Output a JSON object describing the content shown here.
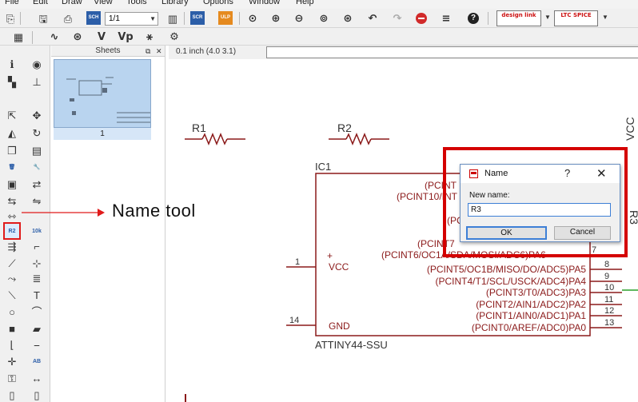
{
  "menu": [
    "File",
    "Edit",
    "Draw",
    "View",
    "Tools",
    "Library",
    "Options",
    "Window",
    "Help"
  ],
  "toolbar1": {
    "zoom_value": "1/1",
    "buttons": [
      {
        "name": "new-sheet-icon",
        "glyph": "⎘"
      },
      {
        "name": "save-icon",
        "glyph": "🖫"
      },
      {
        "name": "print-icon",
        "glyph": "⎙"
      },
      {
        "name": "cam-icon",
        "glyph": "SCH"
      },
      {
        "name": "bus-view-icon",
        "glyph": "▥"
      },
      {
        "name": "zoom-in-icon",
        "glyph": "⊕"
      },
      {
        "name": "zoom-out-icon",
        "glyph": "⊖"
      },
      {
        "name": "zoom-fit-icon",
        "glyph": "⊙"
      },
      {
        "name": "undo-icon",
        "glyph": "↶"
      },
      {
        "name": "redo-icon",
        "glyph": "↷"
      },
      {
        "name": "stop-icon",
        "glyph": "⛔"
      },
      {
        "name": "go-icon",
        "glyph": "≡"
      },
      {
        "name": "help-icon",
        "glyph": "?"
      }
    ],
    "design_link_label": "design link",
    "ltspice_label": "LTC SPICE",
    "scr_label": "SCR",
    "ulp_label": "ULP"
  },
  "toolbar2": {
    "buttons": [
      {
        "name": "grid-icon",
        "glyph": "▦"
      },
      {
        "name": "wire-style-icon",
        "glyph": "∿"
      },
      {
        "name": "search-icon",
        "glyph": "🔍"
      },
      {
        "name": "value-icon",
        "glyph": "V"
      },
      {
        "name": "value-pin-icon",
        "glyph": "Vp"
      },
      {
        "name": "share-icon",
        "glyph": "⚹"
      },
      {
        "name": "settings-icon",
        "glyph": "⚙"
      }
    ]
  },
  "tools": [
    {
      "name": "info-icon",
      "glyph": "ℹ"
    },
    {
      "name": "show-icon",
      "glyph": "◉"
    },
    {
      "name": "display-icon",
      "glyph": "▚"
    },
    {
      "name": "mark-icon",
      "glyph": "⊥"
    },
    {
      "name": "move-icon",
      "glyph": "⇱"
    },
    {
      "name": "move-all-icon",
      "glyph": "✥"
    },
    {
      "name": "mirror-icon",
      "glyph": "◭"
    },
    {
      "name": "rotate-icon",
      "glyph": "↻"
    },
    {
      "name": "copy-icon",
      "glyph": "❐"
    },
    {
      "name": "paste-icon",
      "glyph": "▤"
    },
    {
      "name": "delete-icon",
      "glyph": "🗑"
    },
    {
      "name": "wrench-icon",
      "glyph": "🔧"
    },
    {
      "name": "add-icon",
      "glyph": "▣"
    },
    {
      "name": "replace-icon",
      "glyph": "⇄"
    },
    {
      "name": "gate-swap-icon",
      "glyph": "⇆"
    },
    {
      "name": "pin-swap-icon",
      "glyph": "⇋"
    },
    {
      "name": "split-icon",
      "glyph": "⇿"
    },
    {
      "name": "blank-icon",
      "glyph": ""
    },
    {
      "name": "name-tool-icon",
      "glyph": "R2"
    },
    {
      "name": "value-tool-icon",
      "glyph": "10k"
    },
    {
      "name": "smash-icon",
      "glyph": "⇶"
    },
    {
      "name": "miter-icon",
      "glyph": "⌐"
    },
    {
      "name": "split-line-icon",
      "glyph": "⟋"
    },
    {
      "name": "optimize-icon",
      "glyph": "⊹"
    },
    {
      "name": "invoke-icon",
      "glyph": "⤳"
    },
    {
      "name": "bus-icon",
      "glyph": "≣"
    },
    {
      "name": "line-icon",
      "glyph": "⟍"
    },
    {
      "name": "text-icon",
      "glyph": "T"
    },
    {
      "name": "circle-icon",
      "glyph": "○"
    },
    {
      "name": "arc-icon",
      "glyph": "⌒"
    },
    {
      "name": "rect-icon",
      "glyph": "■"
    },
    {
      "name": "polygon-icon",
      "glyph": "▰"
    },
    {
      "name": "net-icon",
      "glyph": "⌊"
    },
    {
      "name": "bus-wire-icon",
      "glyph": "⎯"
    },
    {
      "name": "junction-icon",
      "glyph": "✛"
    },
    {
      "name": "label-icon",
      "glyph": "AB"
    },
    {
      "name": "attribute-icon",
      "glyph": "⚿"
    },
    {
      "name": "dimension-icon",
      "glyph": "↔"
    },
    {
      "name": "frame-icon",
      "glyph": "▯"
    },
    {
      "name": "module-icon",
      "glyph": "▯"
    },
    {
      "name": "erc-icon",
      "glyph": "ERC"
    },
    {
      "name": "warning-icon",
      "glyph": "⚠"
    }
  ],
  "sheets": {
    "title": "Sheets",
    "thumb_number": "1"
  },
  "coordinate": "0.1 inch (4.0 3.1)",
  "schematic": {
    "r1": "R1",
    "r2": "R2",
    "vcc_top": "VCC",
    "r3_partial": "R3",
    "ic_name": "IC1",
    "ic_value": "ATTINY44-SSU",
    "vcc_pin_num": "1",
    "vcc_pin": "VCC",
    "gnd_pin_num": "14",
    "gnd_pin": "GND",
    "plus": "+",
    "pins_partial": [
      "(PCINT",
      "(PCINT10/INT",
      "(PC",
      "(PCINT7",
      "(PCINT6/OC1A/SDA/MOSI/ADC6)PA6"
    ],
    "pins": [
      {
        "label": "(PCINT5/OC1B/MISO/DO/ADC5)PA5",
        "num": "8"
      },
      {
        "label": "(PCINT4/T1/SCL/USCK/ADC4)PA4",
        "num": "9"
      },
      {
        "label": "(PCINT3/T0/ADC3)PA3",
        "num": "10"
      },
      {
        "label": "(PCINT2/AIN1/ADC2)PA2",
        "num": "11"
      },
      {
        "label": "(PCINT1/AIN0/ADC1)PA1",
        "num": "12"
      },
      {
        "label": "(PCINT0/AREF/ADC0)PA0",
        "num": "13"
      }
    ],
    "pin7": "7"
  },
  "annotation": "Name tool",
  "dialog": {
    "title": "Name",
    "help": "?",
    "close": "✕",
    "label": "New name:",
    "value": "R3",
    "ok": "OK",
    "cancel": "Cancel"
  },
  "colors": {
    "net": "#8b1a1a",
    "annotation_red": "#e01b1b",
    "dialog_frame": "#d40000",
    "ic_text": "#8b1a1a",
    "green_wire": "#2aa02a"
  }
}
